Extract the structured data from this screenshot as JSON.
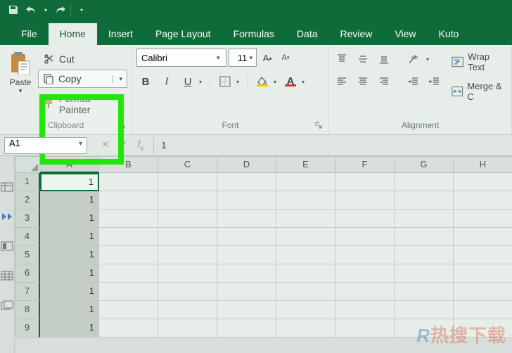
{
  "qat": {
    "save": "save",
    "undo": "undo",
    "redo": "redo"
  },
  "tabs": {
    "file": "File",
    "home": "Home",
    "insert": "Insert",
    "page_layout": "Page Layout",
    "formulas": "Formulas",
    "data": "Data",
    "review": "Review",
    "view": "View",
    "kutools": "Kuto"
  },
  "ribbon": {
    "clipboard": {
      "label": "Clipboard",
      "paste": "Paste",
      "cut": "Cut",
      "copy": "Copy",
      "format_painter": "Format Painter"
    },
    "font": {
      "label": "Font",
      "name": "Calibri",
      "size": "11",
      "bold": "B",
      "italic": "I",
      "underline": "U"
    },
    "alignment": {
      "label": "Alignment",
      "wrap": "Wrap Text",
      "merge": "Merge & C"
    }
  },
  "namebox": "A1",
  "formula_value": "1",
  "columns": [
    "A",
    "B",
    "C",
    "D",
    "E",
    "F",
    "G",
    "H"
  ],
  "rows": [
    {
      "num": "1",
      "a": "1"
    },
    {
      "num": "2",
      "a": "1"
    },
    {
      "num": "3",
      "a": "1"
    },
    {
      "num": "4",
      "a": "1"
    },
    {
      "num": "5",
      "a": "1"
    },
    {
      "num": "6",
      "a": "1"
    },
    {
      "num": "7",
      "a": "1"
    },
    {
      "num": "8",
      "a": "1"
    },
    {
      "num": "9",
      "a": "1"
    }
  ],
  "watermark": {
    "r": "R",
    "text": "热搜下载"
  }
}
